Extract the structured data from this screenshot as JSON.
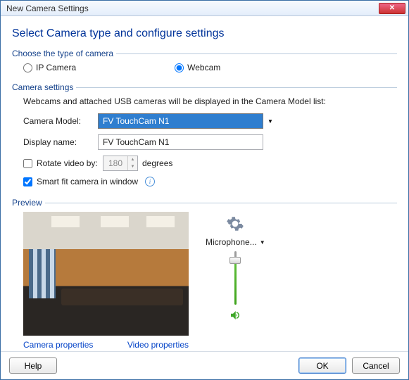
{
  "window": {
    "title": "New Camera Settings"
  },
  "heading": "Select Camera type and configure settings",
  "groups": {
    "type": {
      "legend": "Choose the type of camera",
      "options": {
        "ip": "IP Camera",
        "webcam": "Webcam"
      },
      "selected": "webcam"
    },
    "settings": {
      "legend": "Camera settings",
      "info": "Webcams and attached USB cameras will be displayed in the Camera Model list:",
      "model_label": "Camera Model:",
      "model_value": "FV TouchCam N1",
      "display_label": "Display name:",
      "display_value": "FV TouchCam N1",
      "rotate_label": "Rotate video by:",
      "rotate_value": "180",
      "rotate_unit": "degrees",
      "rotate_checked": false,
      "smartfit_label": "Smart fit camera in window",
      "smartfit_checked": true
    },
    "preview": {
      "legend": "Preview",
      "camera_props": "Camera properties",
      "video_props": "Video properties",
      "mic_label": "Microphone..."
    }
  },
  "footer": {
    "help": "Help",
    "ok": "OK",
    "cancel": "Cancel"
  }
}
